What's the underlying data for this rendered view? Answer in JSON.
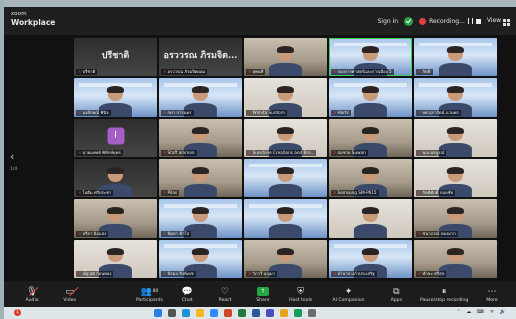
{
  "app": {
    "logo_line1": "zoom",
    "logo_line2": "Workplace"
  },
  "titlebar": {
    "signin": "Sign in",
    "recording": "Recording...",
    "view": "View"
  },
  "sidebar": {
    "prev_arrow": "‹",
    "page": "1/4"
  },
  "gallery": {
    "tiles": [
      {
        "name": "ปรีชาติ",
        "big": "ปรีชาติ",
        "style": "dark"
      },
      {
        "name": "อรววรณ  ภิรมจิตผอม",
        "big": "อรววรณ  ภิรมจิต...",
        "style": "dark"
      },
      {
        "name": "ยุพนที",
        "style": "room"
      },
      {
        "name": "กองการศาสตร์และการเมือง 5",
        "style": "slide",
        "active": true
      },
      {
        "name": "กิตติ",
        "style": "slide"
      },
      {
        "name": "นงลักษณ์ พินิจ",
        "style": "slide"
      },
      {
        "name": "กดา การนคร",
        "style": "slide"
      },
      {
        "name": "Wimita Suntorn",
        "style": "light"
      },
      {
        "name": "Harts",
        "style": "slide"
      },
      {
        "name": "ผศ.สุภารัตน์ นามพร",
        "style": "slide"
      },
      {
        "name": "นายแพทย์ พิทักษ์ยุทธ",
        "style": "dark",
        "avatar": "I"
      },
      {
        "name": "Staff ammon",
        "style": "room"
      },
      {
        "name": "Sunshine Creations and Bro...",
        "style": "light"
      },
      {
        "name": "สมชาย Suwan",
        "style": "room"
      },
      {
        "name": "คุณ ผลบูรณ์",
        "style": "light"
      },
      {
        "name": "ไอตีม ศรีประชา",
        "style": "dark"
      },
      {
        "name": "Pilas",
        "style": "room"
      },
      {
        "name": "",
        "style": "slide"
      },
      {
        "name": "Samsung SM-P615",
        "style": "room"
      },
      {
        "name": "กิตติศักดิ์ กมลชัย",
        "style": "light"
      },
      {
        "name": "ปรียา นิลแสง",
        "style": "room"
      },
      {
        "name": "นิตยา ฟ้าใส",
        "style": "slide"
      },
      {
        "name": "",
        "style": "slide"
      },
      {
        "name": "",
        "style": "light"
      },
      {
        "name": "ชนาภรณ์ ทองมาก",
        "style": "room"
      },
      {
        "name": "ณัฐวุฒิ ก้อนทอง",
        "style": "light"
      },
      {
        "name": "นิรมล สิงห์เดช",
        "style": "slide"
      },
      {
        "name": "วิภาวี บุญมา",
        "style": "room"
      },
      {
        "name": "อำนาจ แก้วประเสริฐ",
        "style": "slide"
      },
      {
        "name": "ทักษะ ศรีสุข",
        "style": "room"
      }
    ]
  },
  "toolbar": {
    "audio": "Audio",
    "video": "Video",
    "participants": "Participants",
    "participants_count": "80",
    "chat": "Chat",
    "react": "React",
    "share": "Share",
    "host_tools": "Host tools",
    "ai_companion": "AI Companion",
    "apps": "Apps",
    "pause_stop": "Pause/stop recording",
    "more": "More"
  },
  "taskbar": {
    "badge": "1"
  },
  "colors": {
    "accent_green": "#23a840",
    "mute_red": "#e04040",
    "background": "#111111"
  }
}
